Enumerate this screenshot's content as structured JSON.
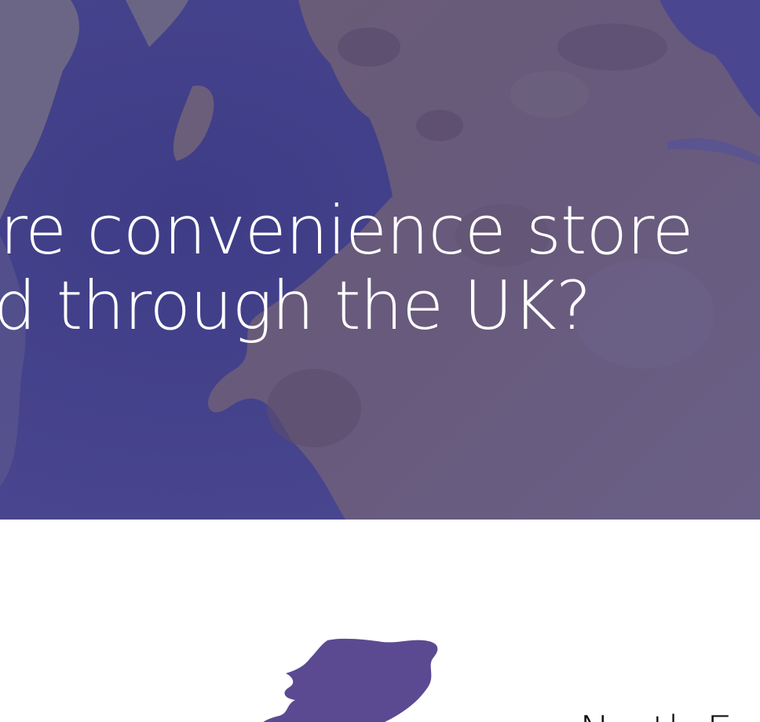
{
  "hero": {
    "headline_line1": "are convenience store",
    "headline_line2": "ad through the UK?",
    "overlay_color": "#4d477f"
  },
  "region": {
    "shape_color": "#5b4a92",
    "label": "North E"
  },
  "icons": {
    "region": "region-map-silhouette-icon"
  }
}
